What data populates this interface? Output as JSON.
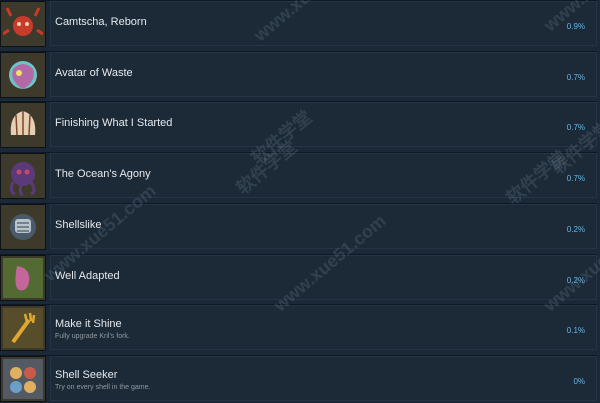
{
  "achievements": [
    {
      "name": "Camtscha, Reborn",
      "desc": "",
      "pct": "0.9%",
      "icon": "crab-icon",
      "colors": [
        "#c83a2a",
        "#e8d2b0"
      ]
    },
    {
      "name": "Avatar of Waste",
      "desc": "",
      "pct": "0.7%",
      "icon": "waste-creature-icon",
      "colors": [
        "#b26aa6",
        "#6cc3c8"
      ]
    },
    {
      "name": "Finishing What I Started",
      "desc": "",
      "pct": "0.7%",
      "icon": "shell-icon",
      "colors": [
        "#e6cfb4",
        "#7a4a2a"
      ]
    },
    {
      "name": "The Ocean's Agony",
      "desc": "",
      "pct": "0.7%",
      "icon": "tentacle-monster-icon",
      "colors": [
        "#5b3a7a",
        "#c84a6a"
      ]
    },
    {
      "name": "Shellslike",
      "desc": "",
      "pct": "0.2%",
      "icon": "armored-crab-icon",
      "colors": [
        "#4a5a6a",
        "#b8c4cc"
      ]
    },
    {
      "name": "Well Adapted",
      "desc": "",
      "pct": "0.2%",
      "icon": "pink-shell-icon",
      "colors": [
        "#c4669a",
        "#6a9a3a"
      ]
    },
    {
      "name": "Make it Shine",
      "desc": "Fully upgrade Kril's fork.",
      "pct": "0.1%",
      "icon": "golden-fork-icon",
      "colors": [
        "#e0a830",
        "#6a5a2a"
      ]
    },
    {
      "name": "Shell Seeker",
      "desc": "Try on every shell in the game.",
      "pct": "0%",
      "icon": "shell-collection-icon",
      "colors": [
        "#e0b060",
        "#6a7a9a"
      ]
    }
  ],
  "watermarks": [
    "www.xue51.com",
    "软件学堂"
  ]
}
